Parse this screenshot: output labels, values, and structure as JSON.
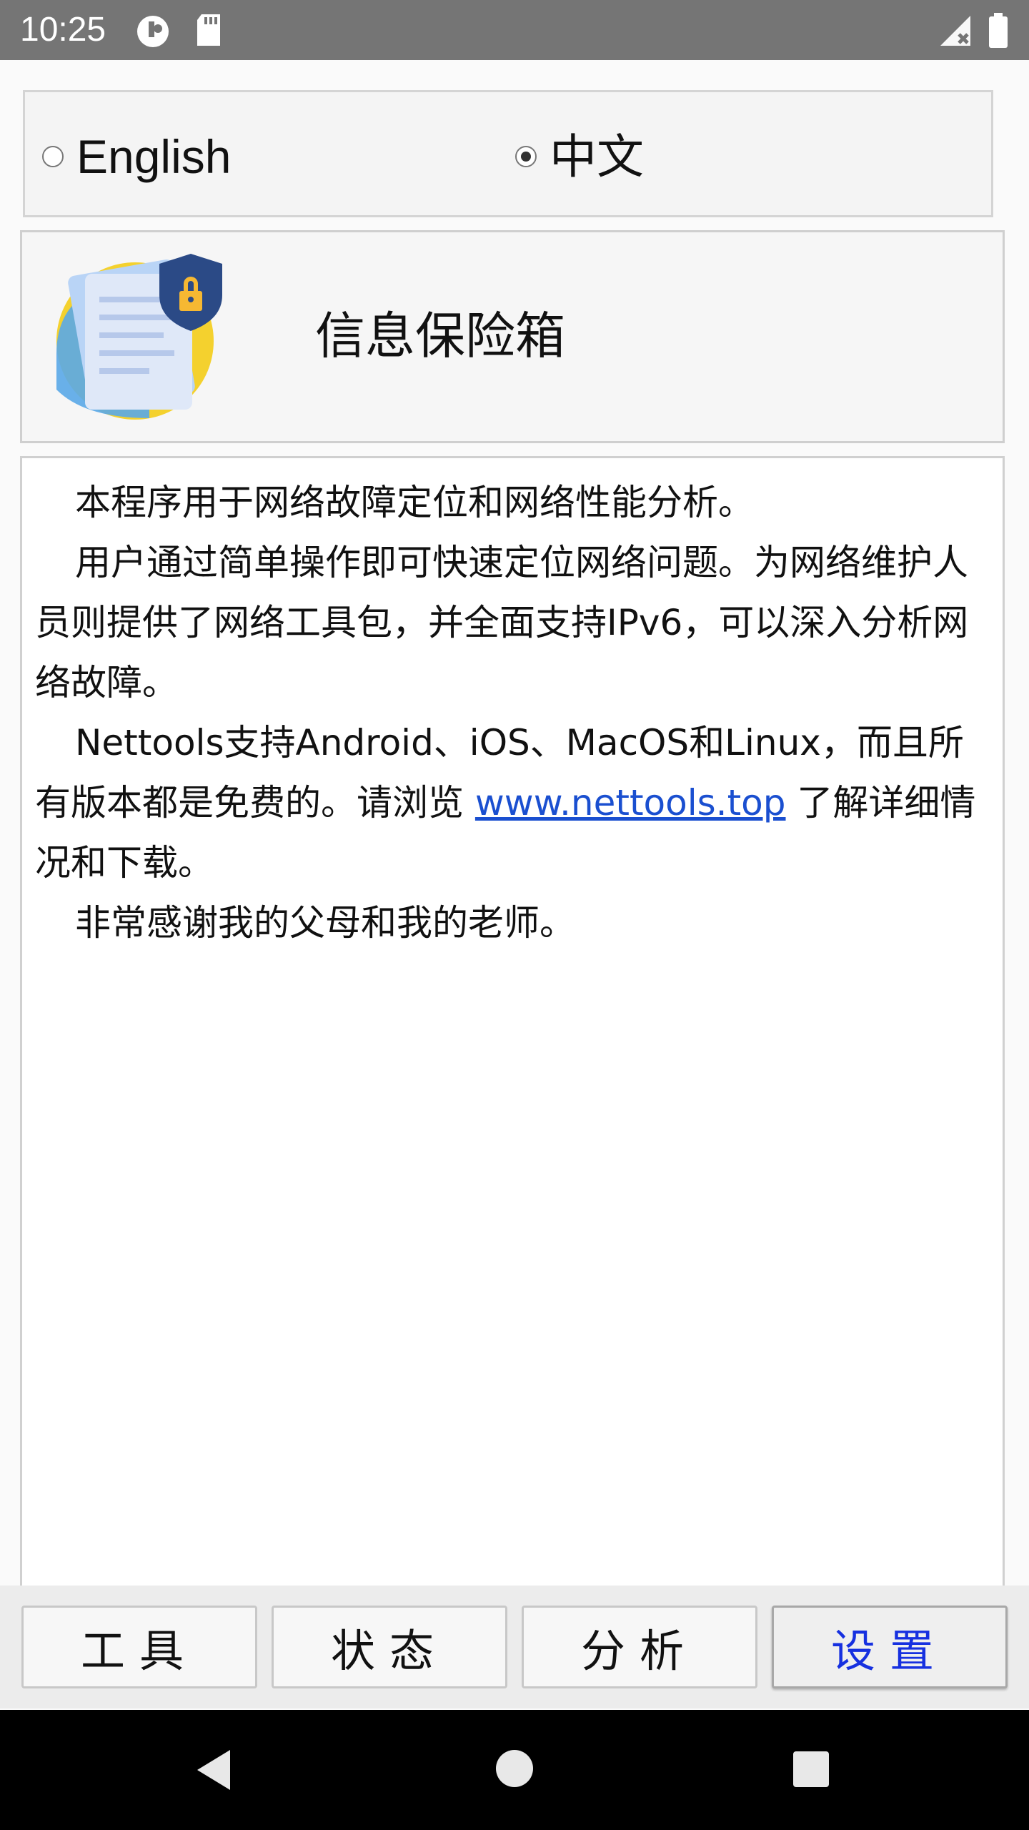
{
  "status_bar": {
    "time": "10:25",
    "icons": [
      "data-saver-icon",
      "sd-card-icon",
      "signal-off-icon",
      "battery-icon"
    ]
  },
  "language": {
    "options": [
      {
        "label": "English",
        "selected": false
      },
      {
        "label": "中文",
        "selected": true
      }
    ]
  },
  "app": {
    "title": "信息保险箱",
    "logo": "document-shield-lock-icon"
  },
  "description": {
    "p1": "本程序用于网络故障定位和网络性能分析。",
    "p2": "用户通过简单操作即可快速定位网络问题。为网络维护人员则提供了网络工具包，并全面支持IPv6，可以深入分析网络故障。",
    "p3_before": "Nettools支持Android、iOS、MacOS和Linux，而且所有版本都是免费的。请浏览 ",
    "p3_link": "www.nettools.top",
    "p3_after": " 了解详细情况和下载。",
    "p4": "非常感谢我的父母和我的老师。"
  },
  "tabs": [
    {
      "label": "工具",
      "active": false
    },
    {
      "label": "状态",
      "active": false
    },
    {
      "label": "分析",
      "active": false
    },
    {
      "label": "设置",
      "active": true
    }
  ],
  "colors": {
    "status_bar": "#757575",
    "link": "#1a4fd0",
    "active_tab": "#1630e0"
  },
  "nav": {
    "icons": [
      "back-icon",
      "home-icon",
      "recents-icon"
    ]
  }
}
